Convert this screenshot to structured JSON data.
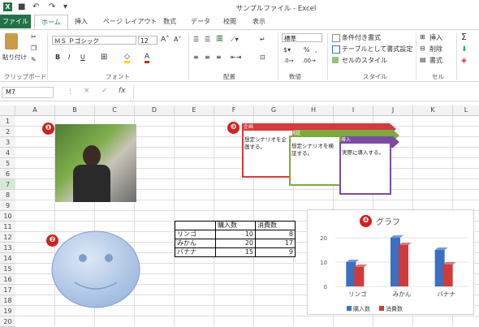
{
  "app": {
    "icon_label": "X",
    "window_title": "サンプルファイル - Excel"
  },
  "tabs": [
    "ファイル",
    "ホーム",
    "挿入",
    "ページ レイアウト",
    "数式",
    "データ",
    "校閲",
    "表示"
  ],
  "ribbon": {
    "clipboard": {
      "paste": "貼り付け",
      "label": "クリップボード"
    },
    "font": {
      "name": "ＭＳ Ｐゴシック",
      "size": "12",
      "label": "フォント",
      "bold": "B",
      "italic": "I",
      "underline": "U"
    },
    "alignment": {
      "label": "配置"
    },
    "number": {
      "format": "標準",
      "label": "数値",
      "percent": "%",
      "comma": ","
    },
    "styles": {
      "conditional": "条件付き書式",
      "table": "テーブルとして書式設定",
      "cell_styles": "セルのスタイル",
      "label": "スタイル"
    },
    "cells": {
      "insert": "挿入",
      "delete": "削除",
      "format": "書式",
      "label": "セル"
    },
    "editing": {
      "sum": "Σ"
    }
  },
  "formula_bar": {
    "cell_ref": "M7",
    "fx": "fx",
    "cancel": "×",
    "confirm": "✓"
  },
  "columns": [
    "A",
    "B",
    "C",
    "D",
    "E",
    "F",
    "G",
    "H",
    "I",
    "J",
    "K",
    "L"
  ],
  "rows": [
    "1",
    "2",
    "3",
    "4",
    "5",
    "6",
    "7",
    "8",
    "9",
    "10",
    "11",
    "12",
    "13",
    "14",
    "15",
    "16",
    "17",
    "18",
    "19",
    "20"
  ],
  "badges": [
    "❶",
    "❷",
    "❸",
    "❹"
  ],
  "table": {
    "headers": [
      "",
      "購入数",
      "消費数"
    ],
    "rows": [
      {
        "name": "リンゴ",
        "bought": "10",
        "consumed": "8"
      },
      {
        "name": "みかん",
        "bought": "20",
        "consumed": "17"
      },
      {
        "name": "バナナ",
        "bought": "15",
        "consumed": "9"
      }
    ]
  },
  "scenario": [
    {
      "header": "企画",
      "text": "想定シナリオを企画する。",
      "color": "#d9383f"
    },
    {
      "header": "検証",
      "text": "想定シナリオを検証する。",
      "color": "#7aab3c"
    },
    {
      "header": "導入",
      "text": "実際に導入する。",
      "color": "#7b4ba3"
    }
  ],
  "chart_data": {
    "type": "bar",
    "title": "グラフ",
    "categories": [
      "リンゴ",
      "みかん",
      "バナナ"
    ],
    "series": [
      {
        "name": "購入数",
        "values": [
          10,
          20,
          15
        ],
        "color": "#3a6fc4"
      },
      {
        "name": "消費数",
        "values": [
          8,
          17,
          9
        ],
        "color": "#d23a3a"
      }
    ],
    "yticks": [
      "0",
      "10",
      "20"
    ],
    "ylim": [
      0,
      20
    ],
    "legend": "bottom"
  }
}
